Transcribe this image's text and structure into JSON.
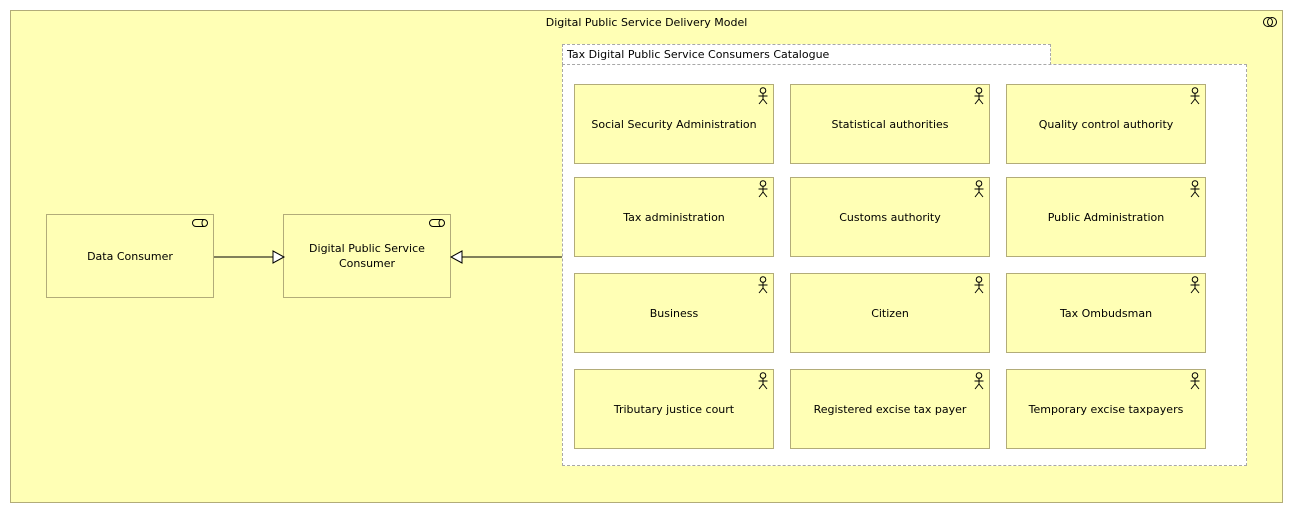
{
  "diagram": {
    "title": "Digital Public Service Delivery Model",
    "title_icon": "grouping-icon",
    "left_nodes": [
      {
        "label": "Data Consumer",
        "icon": "business-role-icon"
      },
      {
        "label": "Digital Public Service Consumer",
        "icon": "business-role-icon"
      }
    ],
    "catalogue": {
      "title": "Tax Digital Public Service Consumers Catalogue",
      "actors": [
        {
          "label": "Social Security Administration",
          "icon": "business-actor-icon"
        },
        {
          "label": "Statistical authorities",
          "icon": "business-actor-icon"
        },
        {
          "label": "Quality control authority",
          "icon": "business-actor-icon"
        },
        {
          "label": "Tax administration",
          "icon": "business-actor-icon"
        },
        {
          "label": "Customs authority",
          "icon": "business-actor-icon"
        },
        {
          "label": "Public Administration",
          "icon": "business-actor-icon"
        },
        {
          "label": "Business",
          "icon": "business-actor-icon"
        },
        {
          "label": "Citizen",
          "icon": "business-actor-icon"
        },
        {
          "label": "Tax Ombudsman",
          "icon": "business-actor-icon"
        },
        {
          "label": "Tributary justice court",
          "icon": "business-actor-icon"
        },
        {
          "label": "Registered excise tax payer",
          "icon": "business-actor-icon"
        },
        {
          "label": "Temporary excise taxpayers",
          "icon": "business-actor-icon"
        }
      ]
    },
    "relationships": [
      {
        "from": "Data Consumer",
        "to": "Digital Public Service Consumer",
        "type": "specialization"
      },
      {
        "from": "Tax Digital Public Service Consumers Catalogue",
        "to": "Digital Public Service Consumer",
        "type": "specialization"
      }
    ],
    "colors": {
      "element_fill": "#ffffb5",
      "element_border": "#b2ac79",
      "catalogue_border": "#a8a8a8"
    }
  }
}
